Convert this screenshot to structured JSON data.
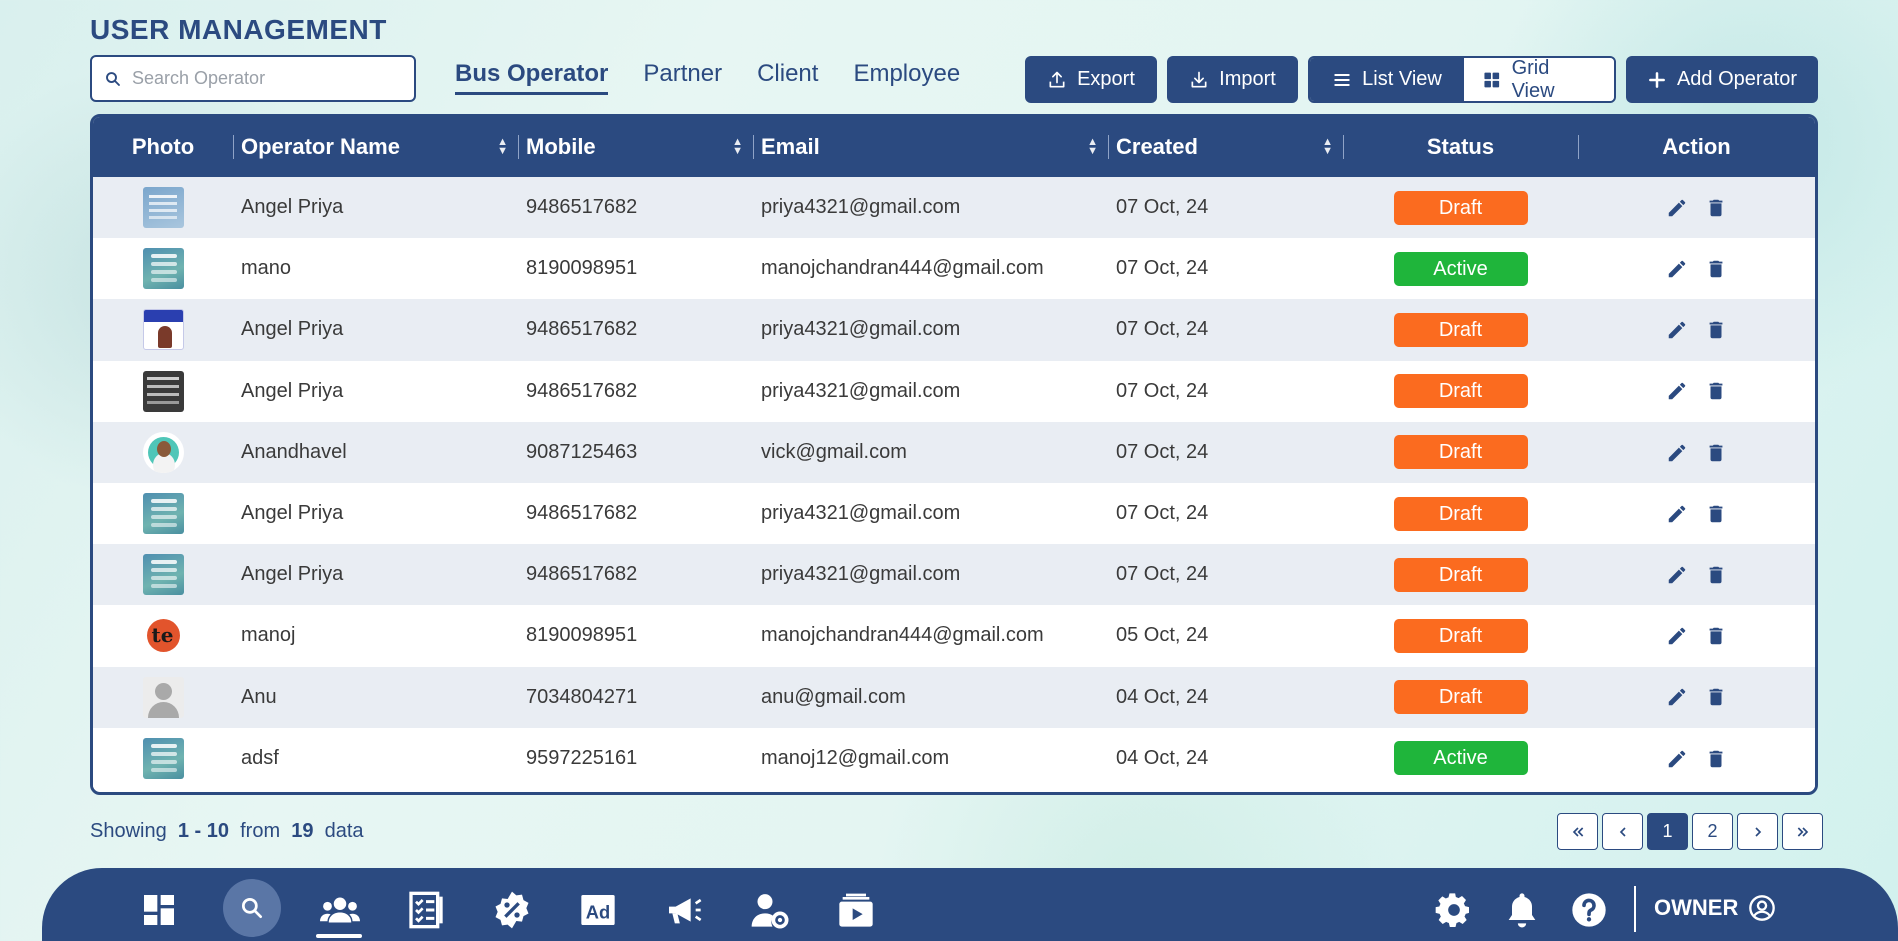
{
  "page": {
    "title": "USER MANAGEMENT"
  },
  "search": {
    "placeholder": "Search Operator",
    "value": ""
  },
  "tabs": [
    {
      "label": "Bus Operator",
      "active": true
    },
    {
      "label": "Partner",
      "active": false
    },
    {
      "label": "Client",
      "active": false
    },
    {
      "label": "Employee",
      "active": false
    }
  ],
  "toolbar": {
    "export_label": "Export",
    "import_label": "Import",
    "list_view_label": "List View",
    "grid_view_label": "Grid View",
    "add_label": "Add Operator"
  },
  "table": {
    "headers": [
      "Photo",
      "Operator Name",
      "Mobile",
      "Email",
      "Created",
      "Status",
      "Action"
    ],
    "rows": [
      {
        "photo": "card2",
        "name": "Angel Priya",
        "mobile": "9486517682",
        "email": "priya4321@gmail.com",
        "created": "07 Oct, 24",
        "status": "Draft"
      },
      {
        "photo": "card",
        "name": "mano",
        "mobile": "8190098951",
        "email": "manojchandran444@gmail.com",
        "created": "07 Oct, 24",
        "status": "Active"
      },
      {
        "photo": "poster",
        "name": "Angel Priya",
        "mobile": "9486517682",
        "email": "priya4321@gmail.com",
        "created": "07 Oct, 24",
        "status": "Draft"
      },
      {
        "photo": "dark",
        "name": "Angel Priya",
        "mobile": "9486517682",
        "email": "priya4321@gmail.com",
        "created": "07 Oct, 24",
        "status": "Draft"
      },
      {
        "photo": "avatar-photo",
        "name": "Anandhavel",
        "mobile": "9087125463",
        "email": "vick@gmail.com",
        "created": "07 Oct, 24",
        "status": "Draft"
      },
      {
        "photo": "card",
        "name": "Angel Priya",
        "mobile": "9486517682",
        "email": "priya4321@gmail.com",
        "created": "07 Oct, 24",
        "status": "Draft"
      },
      {
        "photo": "card",
        "name": "Angel Priya",
        "mobile": "9486517682",
        "email": "priya4321@gmail.com",
        "created": "07 Oct, 24",
        "status": "Draft"
      },
      {
        "photo": "logo",
        "name": "manoj",
        "mobile": "8190098951",
        "email": "manojchandran444@gmail.com",
        "created": "05 Oct, 24",
        "status": "Draft"
      },
      {
        "photo": "user",
        "name": "Anu",
        "mobile": "7034804271",
        "email": "anu@gmail.com",
        "created": "04 Oct, 24",
        "status": "Draft"
      },
      {
        "photo": "card",
        "name": "adsf",
        "mobile": "9597225161",
        "email": "manoj12@gmail.com",
        "created": "04 Oct, 24",
        "status": "Active"
      }
    ]
  },
  "footer": {
    "showing_label": "Showing",
    "range": "1 - 10",
    "from_label": "from",
    "total": "19",
    "data_label": "data"
  },
  "pagination": {
    "pages": [
      "1",
      "2"
    ],
    "current": "1"
  },
  "bottom_nav": {
    "items": [
      "dashboard-icon",
      "search-icon",
      "users-icon",
      "checklist-icon",
      "offers-icon",
      "ads-icon",
      "promotion-icon",
      "user-settings-icon",
      "media-icon"
    ],
    "right_icons": [
      "settings-icon",
      "bell-icon",
      "help-icon"
    ],
    "owner_label": "OWNER"
  },
  "colors": {
    "primary": "#2b4a80",
    "draft": "#fb6b1f",
    "active": "#1fb53b"
  }
}
